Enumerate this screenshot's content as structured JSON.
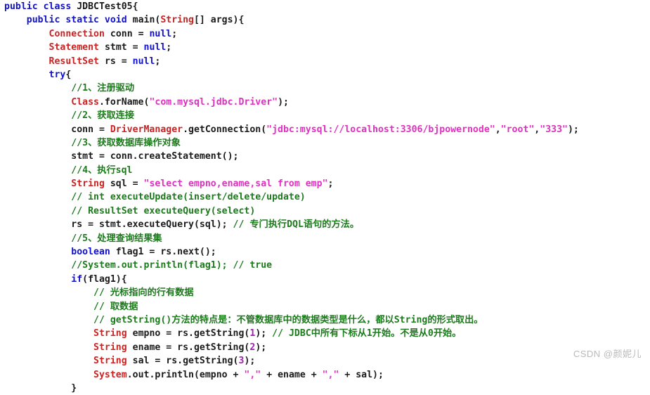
{
  "editor": {
    "language": "Java",
    "background_color": "#ffffff",
    "syntax_colors": {
      "keyword": "#1111cc",
      "type": "#cc2222",
      "string": "#e030c0",
      "comment": "#1d7a1d",
      "number": "#a020b0",
      "plain": "#1a1a1a"
    },
    "class_name": "JDBCTest05"
  },
  "watermark": {
    "text": "CSDN @颜妮儿"
  },
  "code": {
    "lines": [
      {
        "indent": 0,
        "tokens": [
          {
            "t": "kw",
            "v": "public class "
          },
          {
            "t": "plain",
            "v": "JDBCTest05{"
          }
        ]
      },
      {
        "indent": 1,
        "tokens": [
          {
            "t": "kw",
            "v": "public static void "
          },
          {
            "t": "plain",
            "v": "main("
          },
          {
            "t": "type",
            "v": "String"
          },
          {
            "t": "plain",
            "v": "[] args){"
          }
        ]
      },
      {
        "indent": 2,
        "tokens": [
          {
            "t": "type",
            "v": "Connection"
          },
          {
            "t": "plain",
            "v": " conn = "
          },
          {
            "t": "kw",
            "v": "null"
          },
          {
            "t": "plain",
            "v": ";"
          }
        ]
      },
      {
        "indent": 2,
        "tokens": [
          {
            "t": "type",
            "v": "Statement"
          },
          {
            "t": "plain",
            "v": " stmt = "
          },
          {
            "t": "kw",
            "v": "null"
          },
          {
            "t": "plain",
            "v": ";"
          }
        ]
      },
      {
        "indent": 2,
        "tokens": [
          {
            "t": "type",
            "v": "ResultSet"
          },
          {
            "t": "plain",
            "v": " rs = "
          },
          {
            "t": "kw",
            "v": "null"
          },
          {
            "t": "plain",
            "v": ";"
          }
        ]
      },
      {
        "indent": 2,
        "tokens": [
          {
            "t": "kw",
            "v": "try"
          },
          {
            "t": "plain",
            "v": "{"
          }
        ]
      },
      {
        "indent": 3,
        "tokens": [
          {
            "t": "cmt",
            "v": "//1、注册驱动"
          }
        ]
      },
      {
        "indent": 3,
        "tokens": [
          {
            "t": "type",
            "v": "Class"
          },
          {
            "t": "plain",
            "v": ".forName("
          },
          {
            "t": "str",
            "v": "\"com.mysql.jdbc.Driver\""
          },
          {
            "t": "plain",
            "v": ");"
          }
        ]
      },
      {
        "indent": 3,
        "tokens": [
          {
            "t": "cmt",
            "v": "//2、获取连接"
          }
        ]
      },
      {
        "indent": 3,
        "tokens": [
          {
            "t": "plain",
            "v": "conn = "
          },
          {
            "t": "type",
            "v": "DriverManager"
          },
          {
            "t": "plain",
            "v": ".getConnection("
          },
          {
            "t": "str",
            "v": "\"jdbc:mysql://localhost:3306/bjpowernode\""
          },
          {
            "t": "plain",
            "v": ","
          },
          {
            "t": "str",
            "v": "\"root\""
          },
          {
            "t": "plain",
            "v": ","
          },
          {
            "t": "str",
            "v": "\"333\""
          },
          {
            "t": "plain",
            "v": ");"
          }
        ]
      },
      {
        "indent": 3,
        "tokens": [
          {
            "t": "cmt",
            "v": "//3、获取数据库操作对象"
          }
        ]
      },
      {
        "indent": 3,
        "tokens": [
          {
            "t": "plain",
            "v": "stmt = conn.createStatement();"
          }
        ]
      },
      {
        "indent": 3,
        "tokens": [
          {
            "t": "cmt",
            "v": "//4、执行sql"
          }
        ]
      },
      {
        "indent": 3,
        "tokens": [
          {
            "t": "type",
            "v": "String"
          },
          {
            "t": "plain",
            "v": " sql = "
          },
          {
            "t": "str",
            "v": "\"select empno,ename,sal from emp\""
          },
          {
            "t": "plain",
            "v": ";"
          }
        ]
      },
      {
        "indent": 3,
        "tokens": [
          {
            "t": "cmt",
            "v": "// int executeUpdate(insert/delete/update)"
          }
        ]
      },
      {
        "indent": 3,
        "tokens": [
          {
            "t": "cmt",
            "v": "// ResultSet executeQuery(select)"
          }
        ]
      },
      {
        "indent": 3,
        "tokens": [
          {
            "t": "plain",
            "v": "rs = stmt.executeQuery(sql); "
          },
          {
            "t": "cmt",
            "v": "// 专门执行DQL语句的方法。"
          }
        ]
      },
      {
        "indent": 3,
        "tokens": [
          {
            "t": "cmt",
            "v": "//5、处理查询结果集"
          }
        ]
      },
      {
        "indent": 3,
        "tokens": [
          {
            "t": "kw",
            "v": "boolean"
          },
          {
            "t": "plain",
            "v": " flag1 = rs.next();"
          }
        ]
      },
      {
        "indent": 3,
        "tokens": [
          {
            "t": "cmt",
            "v": "//System.out.println(flag1); // true"
          }
        ]
      },
      {
        "indent": 3,
        "tokens": [
          {
            "t": "kw",
            "v": "if"
          },
          {
            "t": "plain",
            "v": "(flag1){"
          }
        ]
      },
      {
        "indent": 4,
        "tokens": [
          {
            "t": "cmt",
            "v": "// 光标指向的行有数据"
          }
        ]
      },
      {
        "indent": 4,
        "tokens": [
          {
            "t": "cmt",
            "v": "// 取数据"
          }
        ]
      },
      {
        "indent": 4,
        "tokens": [
          {
            "t": "cmt",
            "v": "// getString()方法的特点是：不管数据库中的数据类型是什么，都以String的形式取出。"
          }
        ]
      },
      {
        "indent": 4,
        "tokens": [
          {
            "t": "type",
            "v": "String"
          },
          {
            "t": "plain",
            "v": " empno = rs.getString("
          },
          {
            "t": "num",
            "v": "1"
          },
          {
            "t": "plain",
            "v": "); "
          },
          {
            "t": "cmt",
            "v": "// JDBC中所有下标从1开始。不是从0开始。"
          }
        ]
      },
      {
        "indent": 4,
        "tokens": [
          {
            "t": "type",
            "v": "String"
          },
          {
            "t": "plain",
            "v": " ename = rs.getString("
          },
          {
            "t": "num",
            "v": "2"
          },
          {
            "t": "plain",
            "v": ");"
          }
        ]
      },
      {
        "indent": 4,
        "tokens": [
          {
            "t": "type",
            "v": "String"
          },
          {
            "t": "plain",
            "v": " sal = rs.getString("
          },
          {
            "t": "num",
            "v": "3"
          },
          {
            "t": "plain",
            "v": ");"
          }
        ]
      },
      {
        "indent": 4,
        "tokens": [
          {
            "t": "type",
            "v": "System"
          },
          {
            "t": "plain",
            "v": ".out.println(empno + "
          },
          {
            "t": "str",
            "v": "\",\""
          },
          {
            "t": "plain",
            "v": " + ename + "
          },
          {
            "t": "str",
            "v": "\",\""
          },
          {
            "t": "plain",
            "v": " + sal);"
          }
        ]
      },
      {
        "indent": 3,
        "tokens": [
          {
            "t": "plain",
            "v": "}"
          }
        ]
      }
    ]
  }
}
